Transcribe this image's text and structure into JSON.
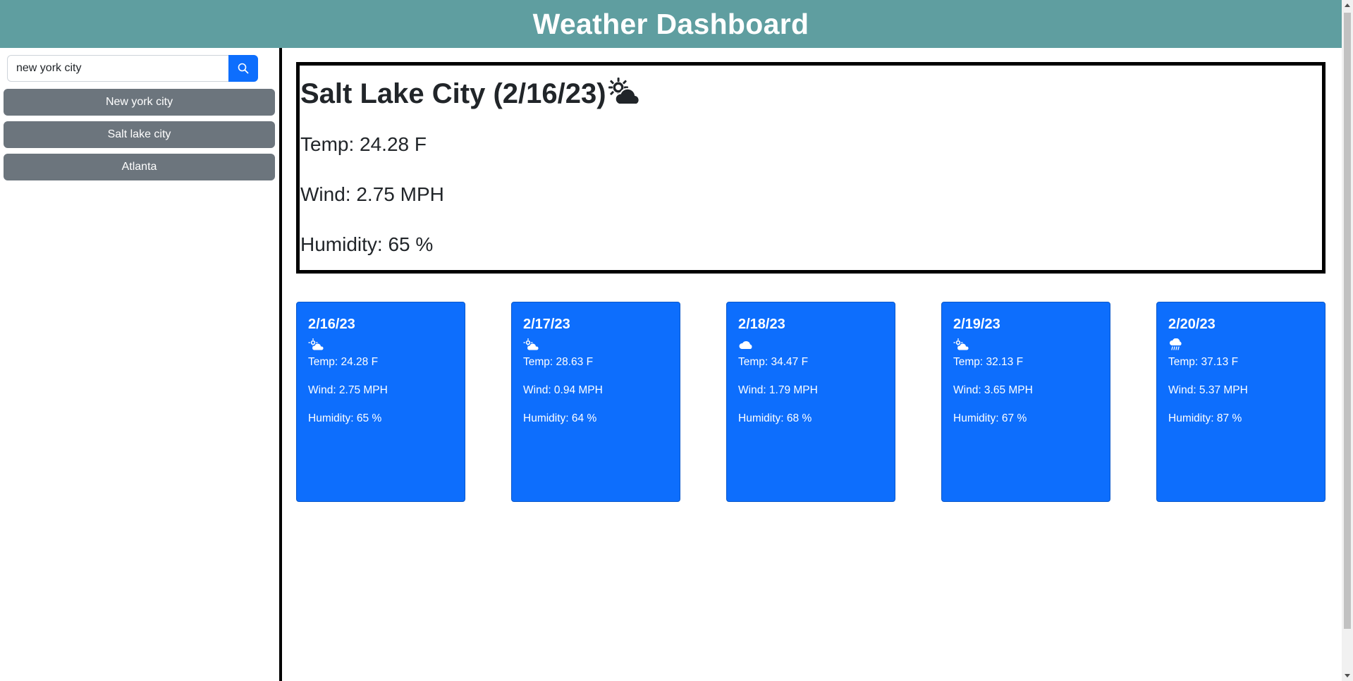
{
  "header": {
    "title": "Weather Dashboard"
  },
  "search": {
    "value": "new york city",
    "button_icon": "search-icon"
  },
  "history": [
    "New york city",
    "Salt lake city",
    "Atlanta"
  ],
  "current": {
    "title": "Salt Lake City (2/16/23)",
    "icon": "partly-cloudy-icon",
    "temp": "Temp: 24.28 F",
    "wind": "Wind: 2.75 MPH",
    "humidity": "Humidity: 65 %"
  },
  "forecast": [
    {
      "date": "2/16/23",
      "icon": "partly-cloudy-icon",
      "temp": "Temp: 24.28 F",
      "wind": "Wind: 2.75 MPH",
      "humidity": "Humidity: 65 %"
    },
    {
      "date": "2/17/23",
      "icon": "partly-cloudy-icon",
      "temp": "Temp: 28.63 F",
      "wind": "Wind: 0.94 MPH",
      "humidity": "Humidity: 64 %"
    },
    {
      "date": "2/18/23",
      "icon": "cloud-icon",
      "temp": "Temp: 34.47 F",
      "wind": "Wind: 1.79 MPH",
      "humidity": "Humidity: 68 %"
    },
    {
      "date": "2/19/23",
      "icon": "partly-cloudy-icon",
      "temp": "Temp: 32.13 F",
      "wind": "Wind: 3.65 MPH",
      "humidity": "Humidity: 67 %"
    },
    {
      "date": "2/20/23",
      "icon": "rain-icon",
      "temp": "Temp: 37.13 F",
      "wind": "Wind: 5.37 MPH",
      "humidity": "Humidity: 87 %"
    }
  ],
  "colors": {
    "header": "#5f9ea0",
    "primary": "#0d6efd",
    "history_button": "#6c757d"
  }
}
